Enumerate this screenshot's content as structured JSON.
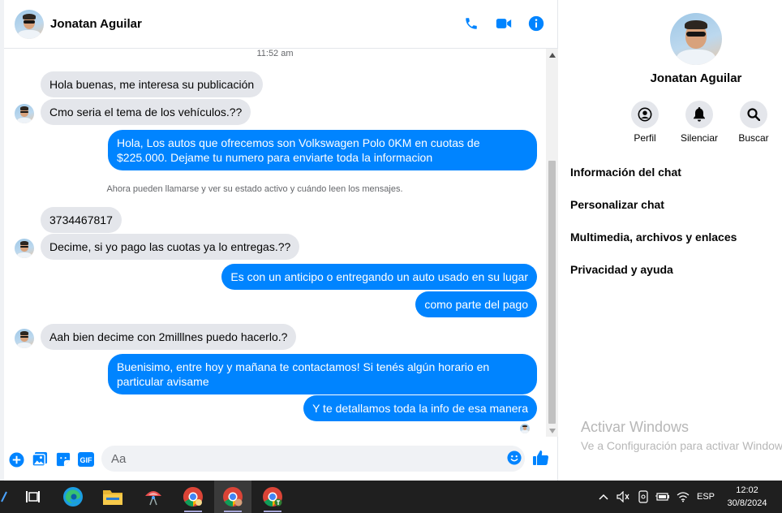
{
  "contact": {
    "name": "Jonatan Aguilar"
  },
  "header_icons": [
    "phone-icon",
    "video-icon",
    "info-icon"
  ],
  "conversation": {
    "timestamp": "11:52 am",
    "system_note": "Ahora pueden llamarse y ver su estado activo y cuándo leen los mensajes.",
    "messages": [
      {
        "from": "in",
        "text": "Hola buenas, me interesa su publicación"
      },
      {
        "from": "in",
        "text": "Cmo seria el tema de los vehículos.??"
      },
      {
        "from": "out",
        "text": "Hola, Los autos que ofrecemos son Volkswagen Polo 0KM en cuotas de $225.000. Dejame tu numero para enviarte toda la informacion"
      },
      {
        "from": "in",
        "text": "3734467817"
      },
      {
        "from": "in",
        "text": "Decime, si yo pago las cuotas ya lo entregas.??"
      },
      {
        "from": "out",
        "text": "Es con un anticipo o entregando un auto usado en su lugar"
      },
      {
        "from": "out",
        "text": "como parte del pago"
      },
      {
        "from": "in",
        "text": "Aah bien decime con 2milllnes puedo hacerlo.?"
      },
      {
        "from": "out",
        "text": "Buenisimo, entre hoy y mañana te contactamos! Si tenés algún horario en particular avisame"
      },
      {
        "from": "out",
        "text": "Y te detallamos toda la info de esa manera"
      }
    ]
  },
  "composer": {
    "placeholder": "Aa",
    "value": "",
    "gif_label": "GIF"
  },
  "info_panel": {
    "name": "Jonatan Aguilar",
    "actions": [
      {
        "label": "Perfil",
        "icon": "profile-icon"
      },
      {
        "label": "Silenciar",
        "icon": "bell-icon"
      },
      {
        "label": "Buscar",
        "icon": "search-icon"
      }
    ],
    "menu": [
      "Información del chat",
      "Personalizar chat",
      "Multimedia, archivos y enlaces",
      "Privacidad y ayuda"
    ]
  },
  "watermark": {
    "title": "Activar Windows",
    "subtitle": "Ve a Configuración para activar Windows."
  },
  "taskbar": {
    "apps": [
      "task-view-icon",
      "edge-icon",
      "file-explorer-icon",
      "app-icon",
      "chrome-icon",
      "chrome-profile-icon",
      "chrome-profile-t-icon"
    ],
    "language": "ESP",
    "time": "12:02",
    "date": "30/8/2024"
  },
  "colors": {
    "accent": "#0084ff",
    "incoming_bubble": "#e4e6eb",
    "taskbar": "#1f1f1f"
  }
}
